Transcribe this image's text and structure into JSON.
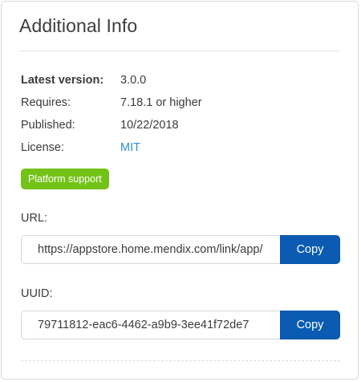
{
  "panel": {
    "title": "Additional Info"
  },
  "meta": [
    {
      "label": "Latest version:",
      "value": "3.0.0"
    },
    {
      "label": "Requires:",
      "value": "7.18.1 or higher"
    },
    {
      "label": "Published:",
      "value": "10/22/2018"
    },
    {
      "label": "License:",
      "value": "MIT"
    }
  ],
  "badge": {
    "label": "Platform support",
    "color": "#73c218"
  },
  "url": {
    "label": "URL:",
    "value": "https://appstore.home.mendix.com/link/app/",
    "button": "Copy"
  },
  "uuid": {
    "label": "UUID:",
    "value": "79711812-eac6-4462-a9b9-3ee41f72de7",
    "button": "Copy"
  },
  "colors": {
    "accent_button": "#0b5bb3",
    "link": "#2d8fd4"
  }
}
